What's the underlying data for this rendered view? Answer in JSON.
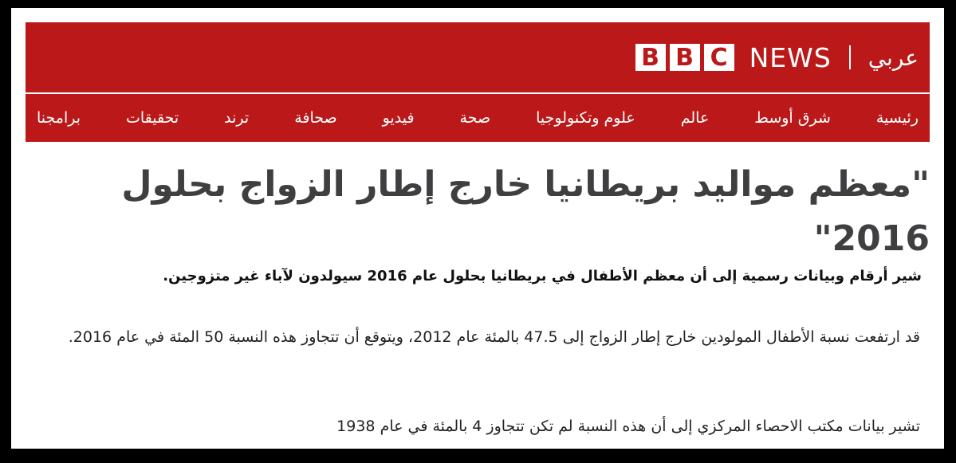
{
  "brand": {
    "bbc_letters": [
      "B",
      "B",
      "C"
    ],
    "news": "NEWS",
    "arabic": "عربي",
    "color": "#bb1919"
  },
  "nav": {
    "items": [
      "رئيسية",
      "شرق أوسط",
      "عالم",
      "علوم وتكنولوجيا",
      "صحة",
      "فيديو",
      "صحافة",
      "ترند",
      "تحقيقات",
      "برامجنا"
    ]
  },
  "article": {
    "headline": "\"معظم مواليد بريطانيا خارج إطار الزواج بحلول 2016\"",
    "summary": "شير أرقام وبيانات رسمية إلى أن معظم الأطفال في بريطانيا بحلول عام 2016 سيولدون لآباء غير متزوجين.",
    "paragraphs": [
      "قد ارتفعت نسبة الأطفال المولودين خارج إطار الزواج إلى 47.5 بالمئة عام 2012، ويتوقع أن تتجاوز هذه النسبة 50 المئة في عام 2016.",
      "تشير بيانات مكتب الاحصاء المركزي إلى أن هذه النسبة لم تكن تتجاوز 4 بالمئة في عام 1938"
    ]
  }
}
